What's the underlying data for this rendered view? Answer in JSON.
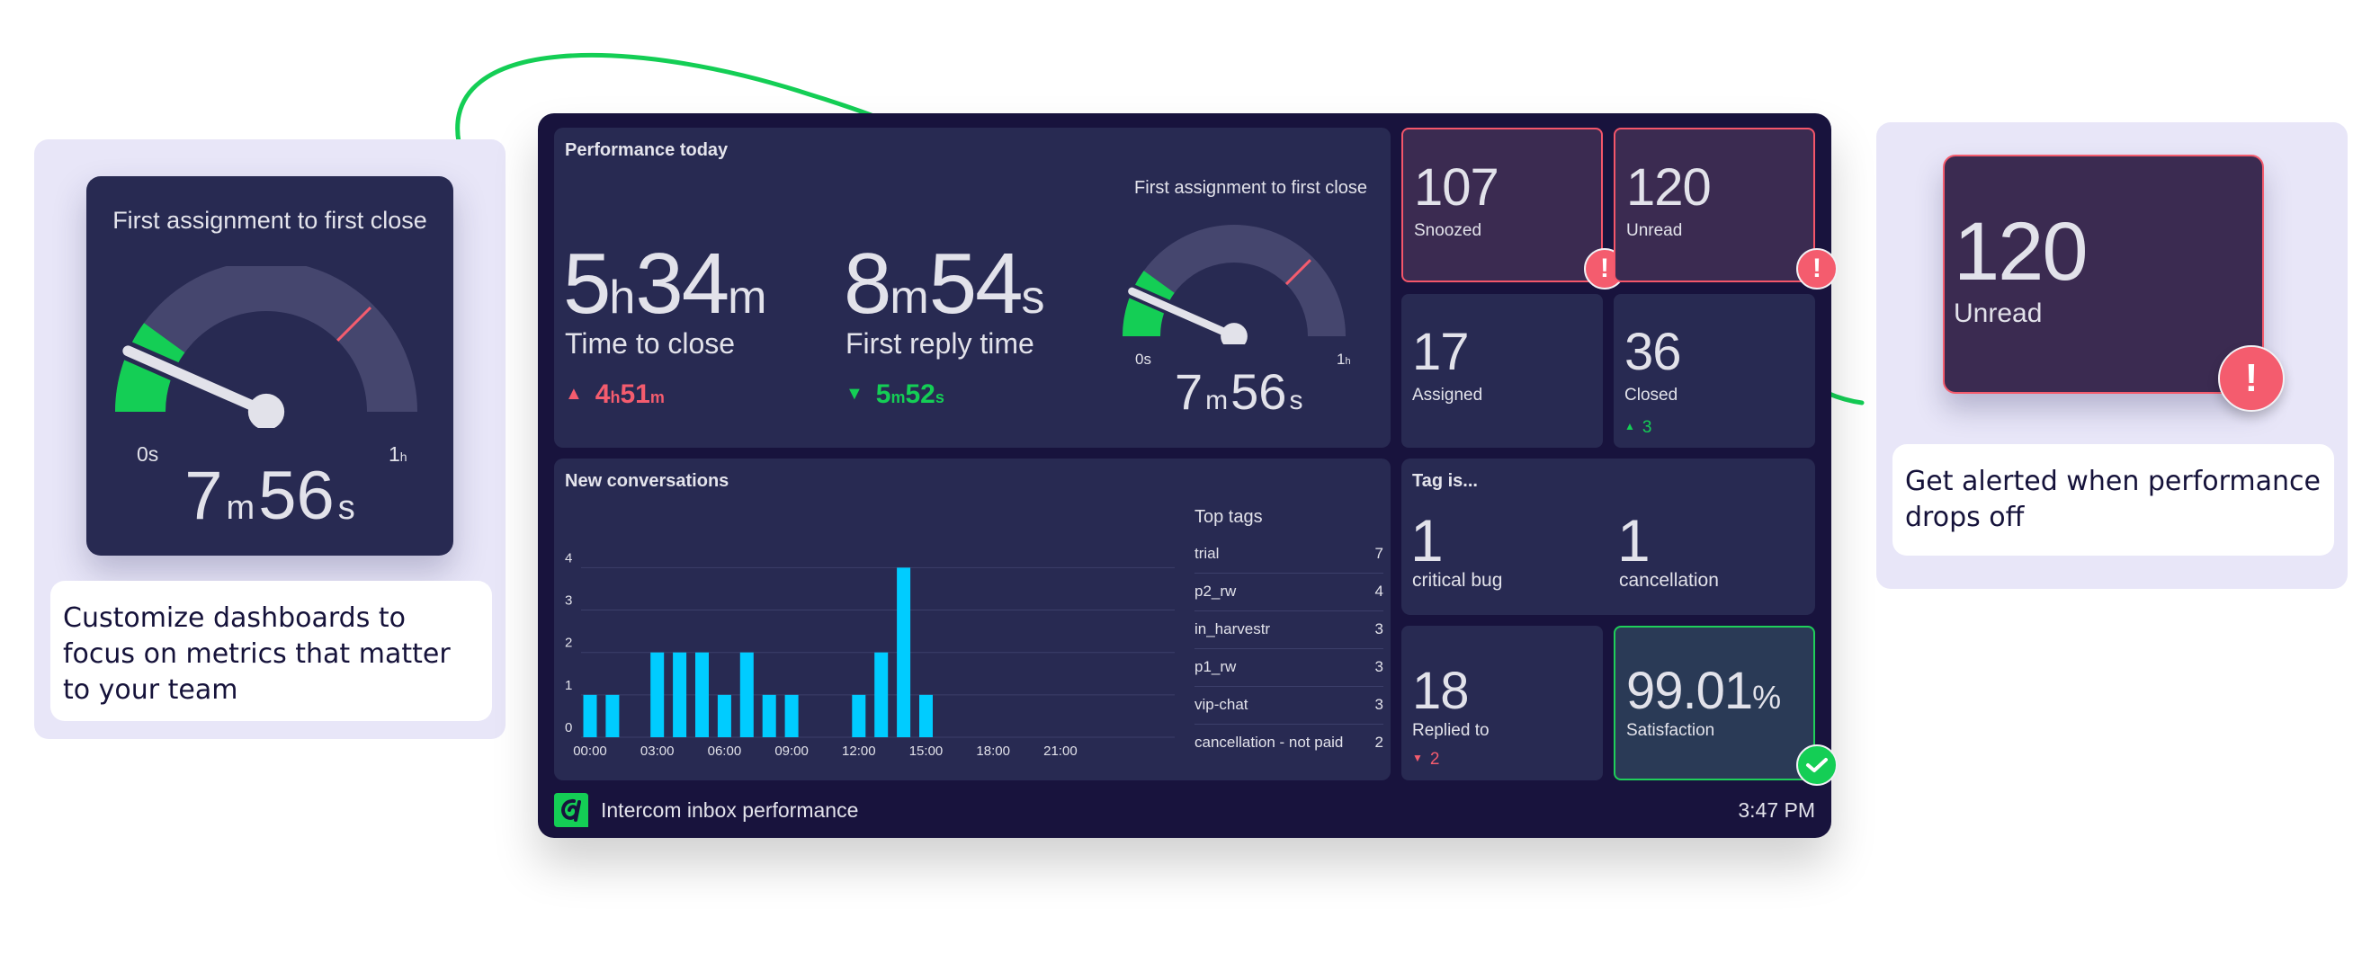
{
  "colors": {
    "accent_green": "#14ce55",
    "alert_red": "#f45c6e",
    "bar_cyan": "#00ccff",
    "dashboard_bg": "#18133d",
    "panel_bg": "#282a52",
    "side_panel_bg": "#e8e6f8"
  },
  "left_callout": {
    "gauge_title": "First assignment to first close",
    "gauge_min_label": "0s",
    "gauge_max_label_num": "1",
    "gauge_max_label_unit": "h",
    "value_parts": [
      {
        "n": "7",
        "u": "m"
      },
      {
        "n": "56",
        "u": "s"
      }
    ],
    "caption": "Customize dashboards to focus on metrics that matter to your team"
  },
  "right_callout": {
    "tile_value": "120",
    "tile_label": "Unread",
    "alert_icon": "exclamation-icon",
    "caption": "Get alerted when performance drops off"
  },
  "dashboard": {
    "performance": {
      "title": "Performance today",
      "time_to_close": {
        "parts": [
          {
            "n": "5",
            "u": "h"
          },
          {
            "n": "34",
            "u": "m"
          }
        ],
        "label": "Time to close",
        "delta_direction": "up",
        "delta_parts": [
          {
            "n": "4",
            "u": "h"
          },
          {
            "n": "51",
            "u": "m"
          }
        ],
        "delta_color": "#f45c6e"
      },
      "first_reply": {
        "parts": [
          {
            "n": "8",
            "u": "m"
          },
          {
            "n": "54",
            "u": "s"
          }
        ],
        "label": "First reply time",
        "delta_direction": "down",
        "delta_parts": [
          {
            "n": "5",
            "u": "m"
          },
          {
            "n": "52",
            "u": "s"
          }
        ],
        "delta_color": "#14ce55"
      },
      "gauge": {
        "title": "First assignment to first close",
        "min_label": "0s",
        "max_label_num": "1",
        "max_label_unit": "h",
        "value_parts": [
          {
            "n": "7",
            "u": "m"
          },
          {
            "n": "56",
            "u": "s"
          }
        ],
        "value_fraction": 0.132,
        "green_zone_fraction": 0.2,
        "threshold_fraction": 0.75
      }
    },
    "tiles": [
      {
        "value": "107",
        "label": "Snoozed",
        "state": "alert"
      },
      {
        "value": "120",
        "label": "Unread",
        "state": "alert"
      },
      {
        "value": "17",
        "label": "Assigned",
        "state": "normal"
      },
      {
        "value": "36",
        "label": "Closed",
        "state": "normal",
        "delta": "3",
        "delta_direction": "up"
      }
    ],
    "new_conversations": {
      "title": "New conversations",
      "top_tags_title": "Top tags",
      "top_tags": [
        {
          "name": "trial",
          "count": "7"
        },
        {
          "name": "p2_rw",
          "count": "4"
        },
        {
          "name": "in_harvestr",
          "count": "3"
        },
        {
          "name": "p1_rw",
          "count": "3"
        },
        {
          "name": "vip-chat",
          "count": "3"
        },
        {
          "name": "cancellation - not paid",
          "count": "2"
        }
      ]
    },
    "tag_is": {
      "title": "Tag is...",
      "items": [
        {
          "value": "1",
          "label": "critical bug"
        },
        {
          "value": "1",
          "label": "cancellation"
        }
      ]
    },
    "replied_to": {
      "value": "18",
      "label": "Replied to",
      "delta": "2",
      "delta_direction": "down"
    },
    "satisfaction": {
      "value": "99.01",
      "unit": "%",
      "label": "Satisfaction",
      "state": "ok"
    },
    "footer": {
      "title": "Intercom inbox performance",
      "time": "3:47 PM"
    }
  },
  "chart_data": {
    "type": "bar",
    "title": "New conversations",
    "xlabel": "",
    "ylabel": "",
    "x": [
      "00:00",
      "01:00",
      "02:00",
      "03:00",
      "04:00",
      "05:00",
      "06:00",
      "07:00",
      "08:00",
      "09:00",
      "10:00",
      "11:00",
      "12:00",
      "13:00",
      "14:00",
      "15:00",
      "16:00",
      "17:00",
      "18:00",
      "19:00",
      "20:00",
      "21:00",
      "22:00",
      "23:00"
    ],
    "values": [
      1,
      1,
      0,
      2,
      2,
      2,
      1,
      2,
      1,
      1,
      0,
      0,
      1,
      2,
      4,
      1,
      0,
      0,
      0,
      0,
      0,
      0,
      0,
      0
    ],
    "x_tick_labels": [
      "00:00",
      "03:00",
      "06:00",
      "09:00",
      "12:00",
      "15:00",
      "18:00",
      "21:00"
    ],
    "y_tick_labels": [
      "0",
      "1",
      "2",
      "3",
      "4"
    ],
    "ylim": [
      0,
      4
    ],
    "grid": true,
    "legend": "none"
  }
}
